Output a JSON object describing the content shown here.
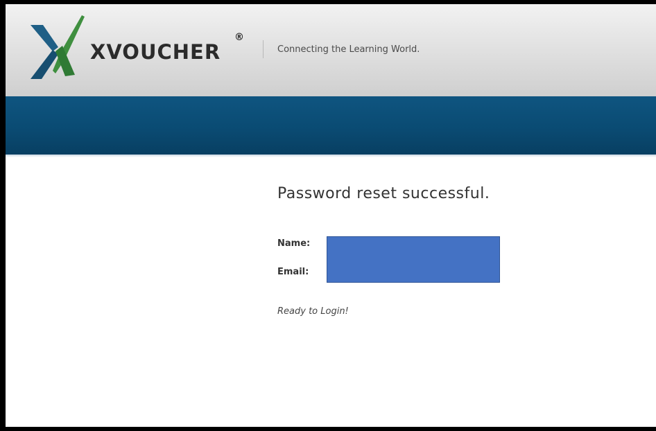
{
  "header": {
    "brand": "XVOUCHER",
    "registered_mark": "®",
    "tagline": "Connecting the Learning World."
  },
  "content": {
    "title": "Password reset successful.",
    "name_label": "Name:",
    "email_label": "Email:",
    "ready_text": "Ready to Login!"
  },
  "colors": {
    "navbar": "#0a4b73",
    "redaction": "#4472c4",
    "logo_blue": "#1f5f86",
    "logo_green": "#3f8f3f"
  },
  "icons": {
    "logo": "xvoucher-x-logo-icon"
  }
}
